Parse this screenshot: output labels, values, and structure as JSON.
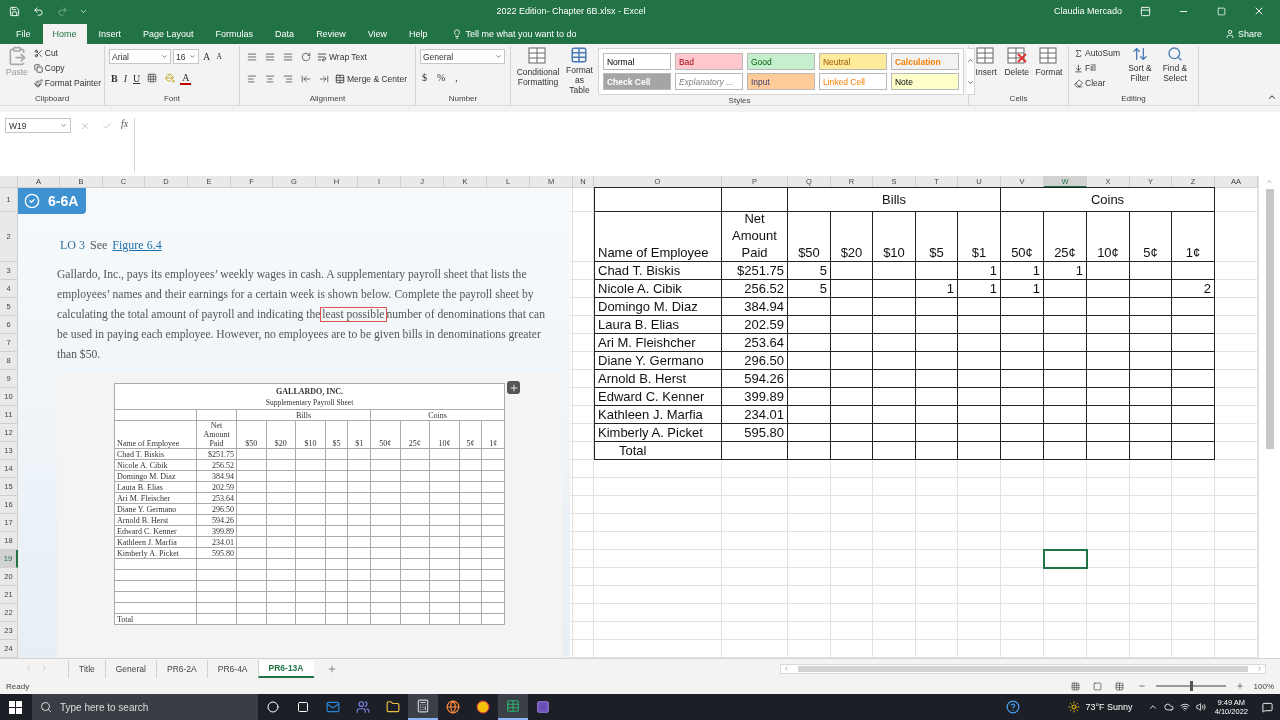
{
  "window": {
    "title": "2022 Edition- Chapter 6B.xlsx  -  Excel",
    "user": "Claudia Mercado",
    "share": "Share"
  },
  "menu": [
    {
      "label": "File",
      "selected": false
    },
    {
      "label": "Home",
      "selected": true
    },
    {
      "label": "Insert",
      "selected": false
    },
    {
      "label": "Page Layout",
      "selected": false
    },
    {
      "label": "Formulas",
      "selected": false
    },
    {
      "label": "Data",
      "selected": false
    },
    {
      "label": "Review",
      "selected": false
    },
    {
      "label": "View",
      "selected": false
    },
    {
      "label": "Help",
      "selected": false
    }
  ],
  "tell_me": "Tell me what you want to do",
  "ribbon": {
    "clipboard": {
      "paste": "Paste",
      "cut": "Cut",
      "copy": "Copy",
      "format_painter": "Format Painter",
      "label": "Clipboard"
    },
    "font": {
      "name": "Arial",
      "size": "16",
      "grow": "A",
      "shrink": "A",
      "bold": "B",
      "italic": "I",
      "underline": "U",
      "font_color": "A",
      "label": "Font"
    },
    "alignment": {
      "wrap": "Wrap Text",
      "merge": "Merge & Center",
      "label": "Alignment"
    },
    "number": {
      "format": "General",
      "currency": "$",
      "percent": "%",
      "comma": ",",
      "label": "Number"
    },
    "styles": {
      "conditional": "Conditional Formatting",
      "format_table": "Format as Table",
      "label": "Styles",
      "gallery": [
        {
          "label": "Normal",
          "kind": "normal",
          "color": "#ffffff"
        },
        {
          "label": "Bad",
          "kind": "bad",
          "color": "#ffc7ce"
        },
        {
          "label": "Good",
          "kind": "good",
          "color": "#c6efce"
        },
        {
          "label": "Neutral",
          "kind": "neutral",
          "color": "#ffeb9c"
        },
        {
          "label": "Calculation",
          "kind": "calculation",
          "color": "#f2f2f2"
        },
        {
          "label": "Check Cell",
          "kind": "check",
          "color": "#a5a5a5"
        },
        {
          "label": "Explanatory ...",
          "kind": "explanatory",
          "color": "#ffffff"
        },
        {
          "label": "Input",
          "kind": "input",
          "color": "#ffcc99"
        },
        {
          "label": "Linked Cell",
          "kind": "linked",
          "color": "#ffffff"
        },
        {
          "label": "Note",
          "kind": "note",
          "color": "#ffffcc"
        }
      ]
    },
    "cells": {
      "insert": "Insert",
      "delete": "Delete",
      "format": "Format",
      "label": "Cells"
    },
    "editing": {
      "autosum": "AutoSum",
      "fill": "Fill",
      "clear": "Clear",
      "sort": "Sort & Filter",
      "find": "Find & Select",
      "label": "Editing"
    }
  },
  "formula_bar": {
    "name_box": "W19",
    "fx": "fx"
  },
  "columns": [
    {
      "label": "A",
      "selected": false
    },
    {
      "label": "B",
      "selected": false
    },
    {
      "label": "C",
      "selected": false
    },
    {
      "label": "D",
      "selected": false
    },
    {
      "label": "E",
      "selected": false
    },
    {
      "label": "F",
      "selected": false
    },
    {
      "label": "G",
      "selected": false
    },
    {
      "label": "H",
      "selected": false
    },
    {
      "label": "I",
      "selected": false
    },
    {
      "label": "J",
      "selected": false
    },
    {
      "label": "K",
      "selected": false
    },
    {
      "label": "L",
      "selected": false
    },
    {
      "label": "M",
      "selected": false
    },
    {
      "label": "N",
      "selected": false
    },
    {
      "label": "O",
      "selected": false
    },
    {
      "label": "P",
      "selected": false
    },
    {
      "label": "Q",
      "selected": false
    },
    {
      "label": "R",
      "selected": false
    },
    {
      "label": "S",
      "selected": false
    },
    {
      "label": "T",
      "selected": false
    },
    {
      "label": "U",
      "selected": false
    },
    {
      "label": "V",
      "selected": false
    },
    {
      "label": "W",
      "selected": true
    },
    {
      "label": "X",
      "selected": false
    },
    {
      "label": "Y",
      "selected": false
    },
    {
      "label": "Z",
      "selected": false
    },
    {
      "label": "AA",
      "selected": false
    }
  ],
  "rows": [
    {
      "label": "1",
      "selected": false
    },
    {
      "label": "2",
      "selected": false
    },
    {
      "label": "3",
      "selected": false
    },
    {
      "label": "4",
      "selected": false
    },
    {
      "label": "5",
      "selected": false
    },
    {
      "label": "6",
      "selected": false
    },
    {
      "label": "7",
      "selected": false
    },
    {
      "label": "8",
      "selected": false
    },
    {
      "label": "9",
      "selected": false
    },
    {
      "label": "10",
      "selected": false
    },
    {
      "label": "11",
      "selected": false
    },
    {
      "label": "12",
      "selected": false
    },
    {
      "label": "13",
      "selected": false
    },
    {
      "label": "14",
      "selected": false
    },
    {
      "label": "15",
      "selected": false
    },
    {
      "label": "16",
      "selected": false
    },
    {
      "label": "17",
      "selected": false
    },
    {
      "label": "18",
      "selected": false
    },
    {
      "label": "19",
      "selected": true
    },
    {
      "label": "20",
      "selected": false
    },
    {
      "label": "21",
      "selected": false
    },
    {
      "label": "22",
      "selected": false
    },
    {
      "label": "23",
      "selected": false
    },
    {
      "label": "24",
      "selected": false
    }
  ],
  "problem": {
    "badge": "6-6A",
    "lo": "LO 3",
    "see": "See",
    "link": "Figure 6.4",
    "text_before": "Gallardo, Inc., pays its employees’ weekly wages in cash. A supplementary payroll sheet that lists the employees’ names and their earnings for a certain week is shown below. Complete the payroll sheet by calculating the total amount of payroll and indicating the",
    "highlight": "least possible",
    "text_after": "number of denominations that can be used in paying each employee. However, no employees are to be given bills in denominations greater than $50."
  },
  "form": {
    "title": "GALLARDO, INC.",
    "subtitle": "Supplementary Payroll Sheet",
    "groups": [
      "Bills",
      "Coins"
    ],
    "name_header": "Name of Employee",
    "amount_header": "Net Amount Paid",
    "denominations": [
      "$50",
      "$20",
      "$10",
      "$5",
      "$1",
      "50¢",
      "25¢",
      "10¢",
      "5¢",
      "1¢"
    ],
    "rows": [
      {
        "name": "Chad T. Biskis",
        "amount": "$251.75"
      },
      {
        "name": "Nicole A. Cibik",
        "amount": "256.52"
      },
      {
        "name": "Domingo M. Diaz",
        "amount": "384.94"
      },
      {
        "name": "Laura B. Elias",
        "amount": "202.59"
      },
      {
        "name": "Ari M. Fleischer",
        "amount": "253.64"
      },
      {
        "name": "Diane Y. Germano",
        "amount": "296.50"
      },
      {
        "name": "Arnold B. Herst",
        "amount": "594.26"
      },
      {
        "name": "Edward C. Kenner",
        "amount": "399.89"
      },
      {
        "name": "Kathleen J. Marfia",
        "amount": "234.01"
      },
      {
        "name": "Kimberly A. Picket",
        "amount": "595.80"
      }
    ],
    "total": "Total"
  },
  "payroll": {
    "groups": [
      "Bills",
      "Coins"
    ],
    "name_header": "Name of Employee",
    "amount_header": "Net Amount Paid",
    "denominations": [
      "$50",
      "$20",
      "$10",
      "$5",
      "$1",
      "50¢",
      "25¢",
      "10¢",
      "5¢",
      "1¢"
    ],
    "rows": [
      {
        "name": "Chad T. Biskis",
        "amount": "$251.75",
        "cells": [
          {
            "kind": "count",
            "value": "5"
          },
          {
            "kind": "blank"
          },
          {
            "kind": "blank"
          },
          {
            "kind": "blank"
          },
          {
            "kind": "count",
            "value": "1"
          },
          {
            "kind": "count",
            "value": "1"
          },
          {
            "kind": "count",
            "value": "1"
          },
          {
            "kind": "blank"
          },
          {
            "kind": "blank"
          },
          {
            "kind": "blank"
          }
        ]
      },
      {
        "name": "Nicole A. Cibik",
        "amount": "256.52",
        "cells": [
          {
            "kind": "count",
            "value": "5"
          },
          {
            "kind": "blank"
          },
          {
            "kind": "blank"
          },
          {
            "kind": "count",
            "value": "1"
          },
          {
            "kind": "count",
            "value": "1"
          },
          {
            "kind": "count",
            "value": "1"
          },
          {
            "kind": "blank"
          },
          {
            "kind": "blank"
          },
          {
            "kind": "blank"
          },
          {
            "kind": "count",
            "value": "2"
          }
        ]
      },
      {
        "name": "Domingo M. Diaz",
        "amount": "384.94"
      },
      {
        "name": "Laura B. Elias",
        "amount": "202.59"
      },
      {
        "name": "Ari M. Fleishcher",
        "amount": "253.64"
      },
      {
        "name": "Diane Y. Germano",
        "amount": "296.50"
      },
      {
        "name": "Arnold B. Herst",
        "amount": "594.26"
      },
      {
        "name": "Edward C. Kenner",
        "amount": "399.89"
      },
      {
        "name": "Kathleen J. Marfia",
        "amount": "234.01"
      },
      {
        "name": "Kimberly A. Picket",
        "amount": "595.80"
      }
    ],
    "total": "Total"
  },
  "sheet_tabs": [
    {
      "label": "Title",
      "selected": false
    },
    {
      "label": "General",
      "selected": false
    },
    {
      "label": "PR6-2A",
      "selected": false
    },
    {
      "label": "PR6-4A",
      "selected": false
    },
    {
      "label": "PR6-13A",
      "selected": true
    }
  ],
  "status_bar": {
    "status": "Ready",
    "zoom": {
      "label": "100%",
      "level": 0.5
    }
  },
  "taskbar": {
    "search_placeholder": "Type here to search",
    "weather": "73°F  Sunny",
    "time": "9:49 AM",
    "date": "4/10/2022"
  }
}
